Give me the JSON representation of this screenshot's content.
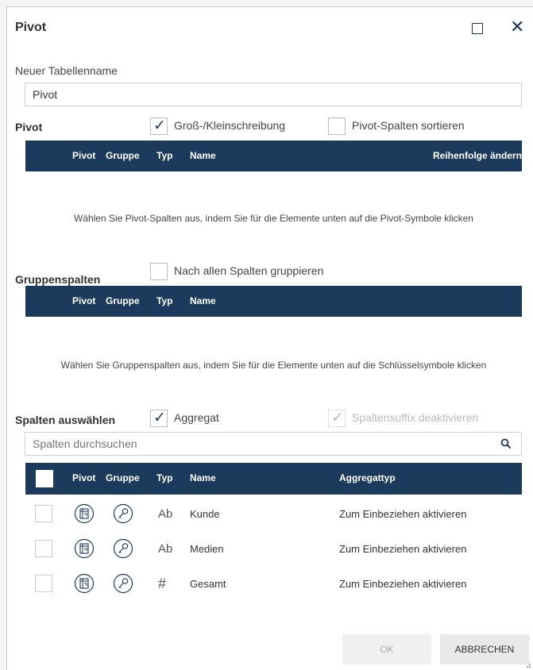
{
  "window": {
    "title": "Pivot"
  },
  "table_name": {
    "label": "Neuer Tabellenname",
    "value": "Pivot"
  },
  "pivot_section": {
    "label": "Pivot",
    "case_sensitive_label": "Groß-/Kleinschreibung",
    "case_sensitive_checked": true,
    "sort_label": "Pivot-Spalten sortieren",
    "sort_checked": false,
    "headers": {
      "pivot": "Pivot",
      "gruppe": "Gruppe",
      "typ": "Typ",
      "name": "Name",
      "order": "Reihenfolge ändern"
    },
    "empty_message": "Wählen Sie Pivot-Spalten aus, indem Sie für die Elemente unten auf die Pivot-Symbole klicken"
  },
  "group_section": {
    "label": "Gruppenspalten",
    "group_all_label": "Nach allen Spalten gruppieren",
    "group_all_checked": false,
    "headers": {
      "pivot": "Pivot",
      "gruppe": "Gruppe",
      "typ": "Typ",
      "name": "Name"
    },
    "empty_message": "Wählen Sie Gruppenspalten aus, indem Sie für die Elemente unten auf die Schlüsselsymbole klicken"
  },
  "columns_section": {
    "label": "Spalten auswählen",
    "aggregate_label": "Aggregat",
    "aggregate_checked": true,
    "suffix_label": "Spaltensuffix deaktivieren",
    "suffix_checked": true,
    "search_placeholder": "Spalten durchsuchen",
    "headers": {
      "pivot": "Pivot",
      "gruppe": "Gruppe",
      "typ": "Typ",
      "name": "Name",
      "aggregate_type": "Aggregattyp"
    },
    "rows": [
      {
        "typ": "Ab",
        "name": "Kunde",
        "aggregate": "Zum Einbeziehen aktivieren"
      },
      {
        "typ": "Ab",
        "name": "Medien",
        "aggregate": "Zum Einbeziehen aktivieren"
      },
      {
        "typ": "#",
        "name": "Gesamt",
        "aggregate": "Zum Einbeziehen aktivieren"
      }
    ]
  },
  "buttons": {
    "ok": "OK",
    "cancel": "ABBRECHEN"
  },
  "colors": {
    "header_bg": "#1b3a5c",
    "accent": "#1b3a5c"
  }
}
